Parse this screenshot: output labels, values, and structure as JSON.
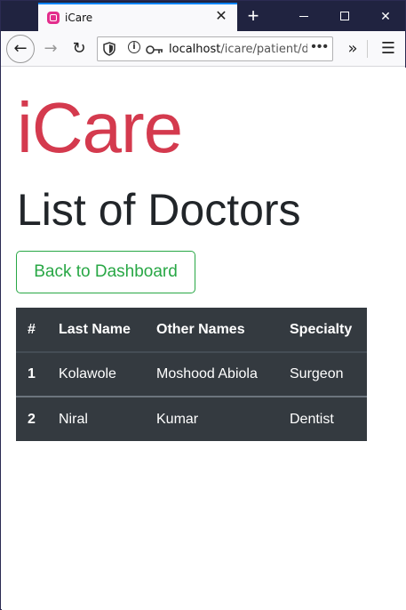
{
  "browser": {
    "tab_title": "iCare",
    "url_host": "localhost",
    "url_path": "/icare/patient/do",
    "new_tab_symbol": "+",
    "close_symbol": "✕",
    "more_symbol": "•••",
    "overflow_symbol": "»",
    "menu_symbol": "☰",
    "back_symbol": "←",
    "forward_symbol": "→",
    "reload_symbol": "↻"
  },
  "page": {
    "brand": "iCare",
    "title": "List of Doctors",
    "back_button_label": "Back to Dashboard",
    "accent_color": "#d43a4e",
    "success_color": "#28a745"
  },
  "table": {
    "headers": [
      "#",
      "Last Name",
      "Other Names",
      "Specialty"
    ],
    "rows": [
      {
        "index": "1",
        "last_name": "Kolawole",
        "other_names": "Moshood Abiola",
        "specialty": "Surgeon"
      },
      {
        "index": "2",
        "last_name": "Niral",
        "other_names": "Kumar",
        "specialty": "Dentist"
      }
    ]
  }
}
